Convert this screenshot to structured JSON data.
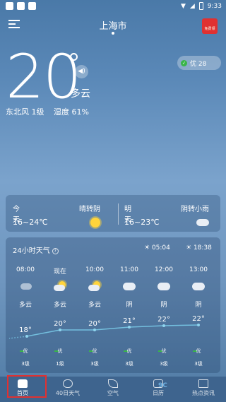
{
  "status_bar": {
    "time": "9:33"
  },
  "header": {
    "city": "上海市",
    "gift_label": "免费领"
  },
  "current": {
    "temperature": "20",
    "condition": "多云",
    "wind": "东北风 1级",
    "humidity": "湿度 61%",
    "aqi_label": "优 28"
  },
  "daily": [
    {
      "label": "今天",
      "range": "16~24℃",
      "condition": "晴转阴",
      "icon": "sun-icon"
    },
    {
      "label": "明天",
      "range": "16~23℃",
      "condition": "阴转小雨",
      "icon": "cloud-icon"
    }
  ],
  "hourly": {
    "title": "24小时天气",
    "sunrise": "05:04",
    "sunset": "18:38",
    "items": [
      {
        "time": "08:00",
        "cond": "多云",
        "temp": "18°",
        "aqi": "优",
        "level": "3级",
        "icon": "partly-cloudy-icon"
      },
      {
        "time": "现在",
        "cond": "多云",
        "temp": "20°",
        "aqi": "优",
        "level": "1级",
        "icon": "partly-cloudy-icon"
      },
      {
        "time": "10:00",
        "cond": "多云",
        "temp": "20°",
        "aqi": "优",
        "level": "3级",
        "icon": "partly-cloudy-icon"
      },
      {
        "time": "11:00",
        "cond": "阴",
        "temp": "21°",
        "aqi": "优",
        "level": "3级",
        "icon": "cloud-icon"
      },
      {
        "time": "12:00",
        "cond": "阴",
        "temp": "22°",
        "aqi": "优",
        "level": "3级",
        "icon": "cloud-icon"
      },
      {
        "time": "13:00",
        "cond": "阴",
        "temp": "22°",
        "aqi": "优",
        "level": "3级",
        "icon": "cloud-icon"
      }
    ]
  },
  "tabs": [
    {
      "label": "首页",
      "icon": "home-icon"
    },
    {
      "label": "40日天气",
      "icon": "cloud-calendar-icon"
    },
    {
      "label": "空气",
      "icon": "leaf-icon"
    },
    {
      "label": "日历",
      "icon": "calendar-icon"
    },
    {
      "label": "热点资讯",
      "icon": "news-icon"
    }
  ],
  "watermark": "9C",
  "colors": {
    "accent_red": "#e03131",
    "aqi_green": "#39b54a",
    "sun": "#ffd43b"
  }
}
